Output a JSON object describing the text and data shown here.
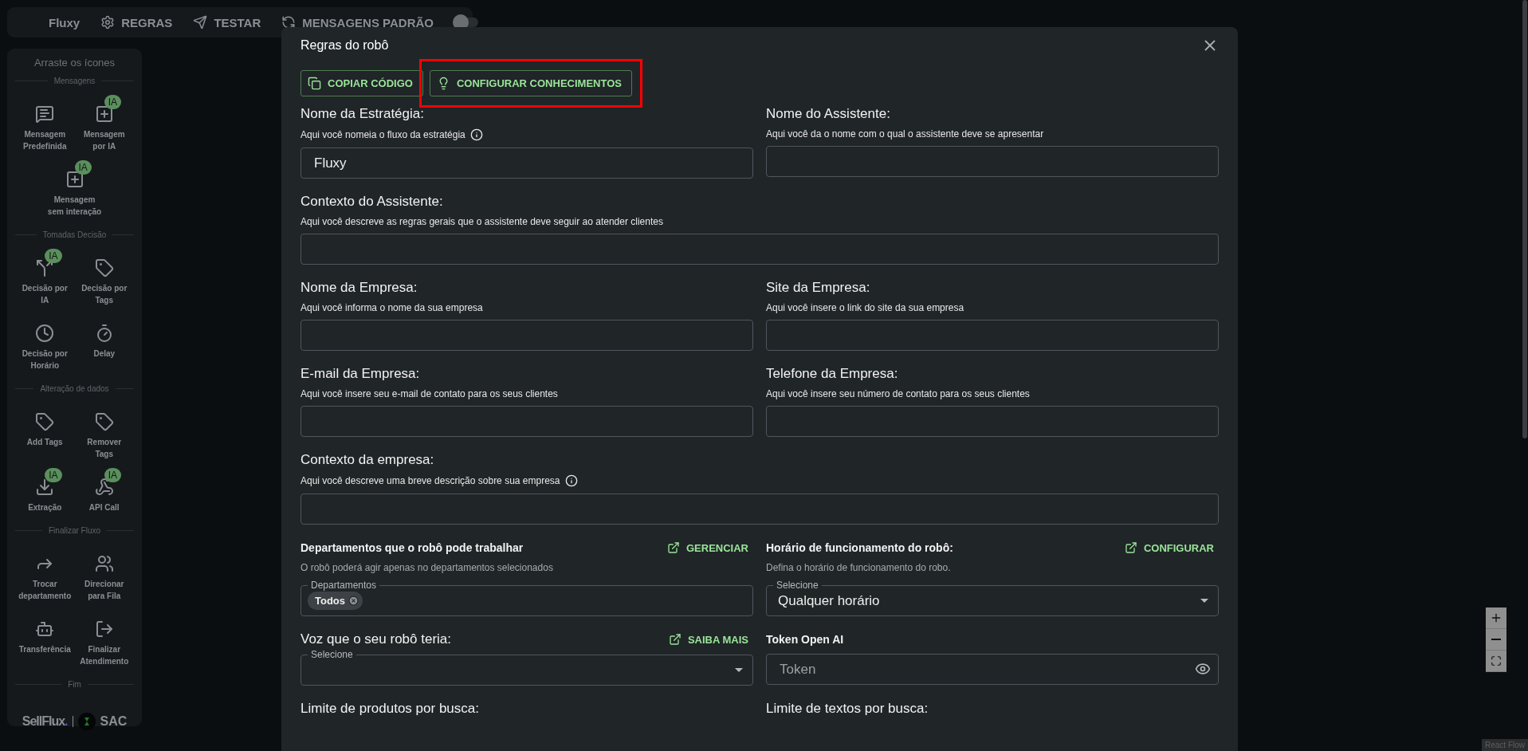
{
  "topbar": {
    "title": "Fluxy",
    "nav": [
      {
        "kind": "gear",
        "label": "REGRAS"
      },
      {
        "kind": "send",
        "label": "TESTAR"
      },
      {
        "kind": "sync",
        "label": "MENSAGENS PADRÃO"
      }
    ],
    "toggle": {
      "on": false
    }
  },
  "sidebar": {
    "title": "Arraste os ícones",
    "sections": [
      {
        "title": "Mensagens",
        "items": [
          {
            "kind": "message",
            "label": "Mensagem Predefinida"
          },
          {
            "kind": "sparkle-message",
            "label": "Mensagem por IA",
            "badge": "IA"
          },
          {
            "kind": "sparkle-box",
            "label": "Mensagem sem interação",
            "badge": "IA"
          }
        ]
      },
      {
        "title": "Tomadas Decisão",
        "items": [
          {
            "kind": "split",
            "label": "Decisão por IA",
            "badge": "IA"
          },
          {
            "kind": "tag",
            "label": "Decisão por Tags"
          },
          {
            "kind": "clock",
            "label": "Decisão por Horário"
          },
          {
            "kind": "timer",
            "label": "Delay"
          }
        ]
      },
      {
        "title": "Alteração de dados",
        "items": [
          {
            "kind": "tag-plus",
            "label": "Add Tags"
          },
          {
            "kind": "tag-minus",
            "label": "Remover Tags"
          },
          {
            "kind": "download",
            "label": "Extração",
            "badge": "IA"
          },
          {
            "kind": "webhook",
            "label": "API Call",
            "badge": "IA"
          }
        ]
      },
      {
        "title": "Finalizar Fluxo",
        "items": [
          {
            "kind": "forward",
            "label": "Trocar departamento"
          },
          {
            "kind": "users",
            "label": "Direcionar para Fila"
          },
          {
            "kind": "bot",
            "label": "Transferência"
          },
          {
            "kind": "logout",
            "label": "Finalizar Atendimento"
          }
        ]
      },
      {
        "title": "Fim"
      }
    ],
    "footer": {
      "brand": "SellFlux",
      "brand_dot": ".",
      "product": "SAC"
    }
  },
  "modal": {
    "title": "Regras do robô",
    "actions": [
      {
        "kind": "copy",
        "label": "COPIAR CÓDIGO"
      },
      {
        "kind": "bulb",
        "label": "CONFIGURAR CONHECIMENTOS",
        "highlighted": true
      }
    ],
    "rows": [
      [
        {
          "kind": "text",
          "title": "Nome da Estratégia:",
          "description": "Aqui você nomeia o fluxo da estratégia",
          "info": true,
          "value": "Fluxy"
        },
        {
          "kind": "text",
          "title": "Nome do Assistente:",
          "description": "Aqui você da o nome com o qual o assistente deve se apresentar"
        }
      ],
      [
        {
          "kind": "text",
          "title": "Contexto do Assistente:",
          "description": "Aqui você descreve as regras gerais que o assistente deve seguir ao atender clientes"
        }
      ],
      [
        {
          "kind": "text",
          "title": "Nome da Empresa:",
          "description": "Aqui você informa o nome da sua empresa"
        },
        {
          "kind": "text",
          "title": "Site da Empresa:",
          "description": "Aqui você insere o link do site da sua empresa"
        }
      ],
      [
        {
          "kind": "text",
          "title": "E-mail da Empresa:",
          "description": "Aqui você insere seu e-mail de contato para os seus clientes"
        },
        {
          "kind": "text",
          "title": "Telefone da Empresa:",
          "description": "Aqui você insere seu número de contato para os seus clientes"
        }
      ],
      [
        {
          "kind": "text",
          "title": "Contexto da empresa:",
          "description": "Aqui você descreve uma breve descrição sobre sua empresa",
          "info": true
        }
      ],
      [
        {
          "kind": "chips",
          "caption": "Departamentos que o robô pode trabalhar",
          "link": "GERENCIAR",
          "description": "O robô poderá agir apenas no departamentos selecionados",
          "legend": "Departamentos",
          "chips": [
            "Todos"
          ]
        },
        {
          "kind": "select",
          "caption": "Horário de funcionamento do robô:",
          "link": "CONFIGURAR",
          "description": "Defina o horário de funcionamento do robo.",
          "legend": "Selecione",
          "value": "Qualquer horário"
        }
      ],
      [
        {
          "kind": "select",
          "title": "Voz que o seu robô teria:",
          "link": "SAIBA MAIS",
          "legend": "Selecione"
        },
        {
          "kind": "secret",
          "caption": "Token Open AI",
          "placeholder": "Token"
        }
      ],
      [
        {
          "kind": "heading",
          "title": "Limite de produtos por busca:"
        },
        {
          "kind": "heading",
          "title": "Limite de textos por busca:"
        }
      ]
    ]
  },
  "attribution": "React Flow"
}
